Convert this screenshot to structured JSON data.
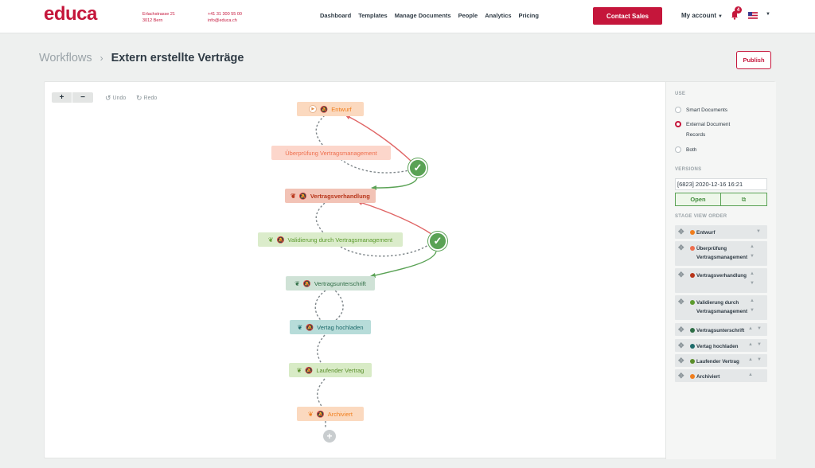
{
  "header": {
    "logo": "educa",
    "address_line1": "Erlachstrasse 21",
    "address_line2": "3012 Bern",
    "phone": "+41 31 300 55 00",
    "email": "info@educa.ch",
    "nav": [
      "Dashboard",
      "Templates",
      "Manage Documents",
      "People",
      "Analytics",
      "Pricing"
    ],
    "contact_label": "Contact Sales",
    "account_label": "My account",
    "notification_count": "4"
  },
  "page": {
    "breadcrumb_root": "Workflows",
    "title": "Extern erstellte Verträge",
    "publish_label": "Publish"
  },
  "toolbar": {
    "zoom_in": "+",
    "zoom_out": "−",
    "undo_label": "Undo",
    "redo_label": "Redo"
  },
  "stages": [
    "Entwurf",
    "Überprüfung Vertragsmanagement",
    "Vertragsverhandlung",
    "Validierung durch Vertragsmanagement",
    "Vertragsunterschrift",
    "Vertag hochladen",
    "Laufender Vertrag",
    "Archiviert"
  ],
  "side_panel": {
    "use_heading": "USE",
    "use_options": [
      "Smart Documents",
      "External Document",
      "Records",
      "Both"
    ],
    "use_selected": "External Document Records",
    "versions_heading": "VERSIONS",
    "version_value": "[6823] 2020-12-16 16:21",
    "open_label": "Open",
    "stage_order_heading": "STAGE VIEW ORDER",
    "stage_order": [
      {
        "label": "Entwurf",
        "color": "#f07e1d"
      },
      {
        "label": "Überprüfung Vertragsmanagement",
        "color": "#ee6e4d"
      },
      {
        "label": "Vertragsverhandlung",
        "color": "#b8361b"
      },
      {
        "label": "Validierung durch Vertragsmanagement",
        "color": "#5c9b2d"
      },
      {
        "label": "Vertragsunterschrift",
        "color": "#2f6e46"
      },
      {
        "label": "Vertag hochladen",
        "color": "#1d6b6b"
      },
      {
        "label": "Laufender Vertrag",
        "color": "#5a8e2a"
      },
      {
        "label": "Archiviert",
        "color": "#f07e1d"
      }
    ]
  }
}
